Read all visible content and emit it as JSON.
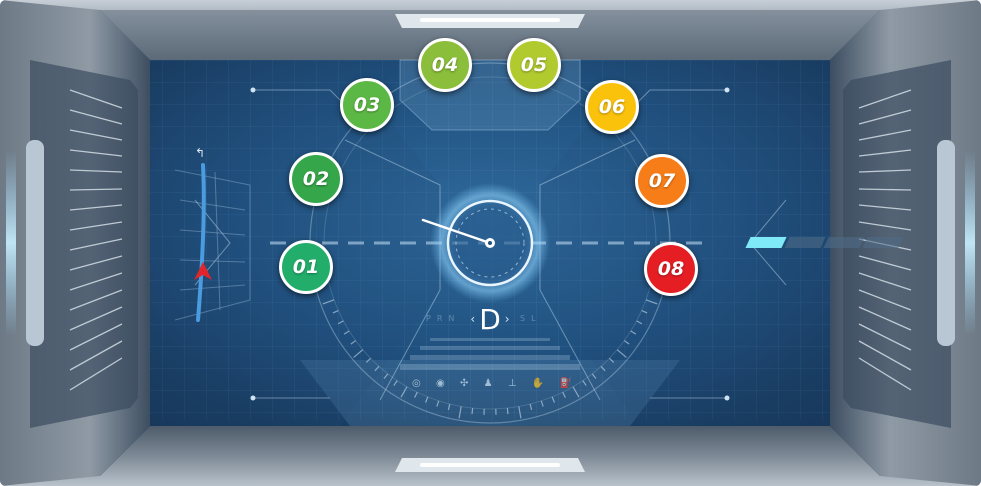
{
  "dashboard": {
    "gear": {
      "current": "D",
      "prev_arrow": "‹",
      "next_arrow": "›",
      "left_letters": "PRN",
      "right_letters": "SL"
    },
    "steps": [
      {
        "label": "01",
        "color": "#22ad6a"
      },
      {
        "label": "02",
        "color": "#36a64a"
      },
      {
        "label": "03",
        "color": "#5cb845"
      },
      {
        "label": "04",
        "color": "#8bbe3a"
      },
      {
        "label": "05",
        "color": "#b1cb2f"
      },
      {
        "label": "06",
        "color": "#fbc20c"
      },
      {
        "label": "07",
        "color": "#f77d18"
      },
      {
        "label": "08",
        "color": "#e51e24"
      }
    ],
    "indicator_icons": [
      "light-icon",
      "eye-icon",
      "fan-icon",
      "seatbelt-icon",
      "wrench-icon",
      "hand-icon",
      "fuel-icon"
    ],
    "level": {
      "segments": 4,
      "filled": 1,
      "fill_color": "#7fe9f7",
      "empty_color": "#4f6a85"
    },
    "nav": {
      "turn_icon": "turn-left-icon",
      "heading_icon": "navigation-arrow-icon"
    }
  }
}
